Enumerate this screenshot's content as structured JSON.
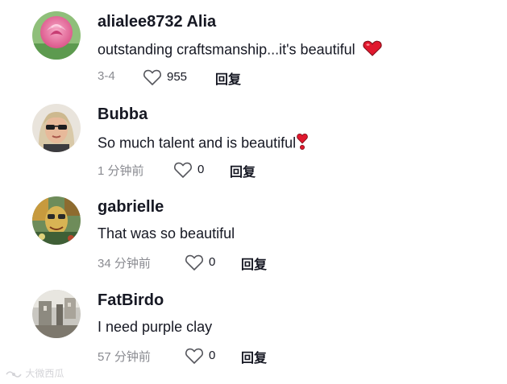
{
  "comments": [
    {
      "username": "alialee8732 Alia",
      "text": "outstanding craftsmanship...it's beautiful",
      "emoji": "red-heart-icon",
      "time": "3-4",
      "likes": "955",
      "reply": "回复",
      "avatar": "pink-rose-avatar"
    },
    {
      "username": "Bubba",
      "text": "So much talent and is beautiful",
      "emoji": "heart-exclamation-icon",
      "time": "1 分钟前",
      "likes": "0",
      "reply": "回复",
      "avatar": "sunglasses-person-avatar"
    },
    {
      "username": "gabrielle",
      "text": "That was so beautiful",
      "time": "34 分钟前",
      "likes": "0",
      "reply": "回复",
      "avatar": "artwork-avatar"
    },
    {
      "username": "FatBirdo",
      "text": "I need purple clay",
      "time": "57 分钟前",
      "likes": "0",
      "reply": "回复",
      "avatar": "photo-avatar"
    }
  ],
  "watermark": "大微西瓜",
  "colors": {
    "text": "#161823",
    "secondary": "#8a8b91",
    "heart_red": "#e0182d"
  }
}
